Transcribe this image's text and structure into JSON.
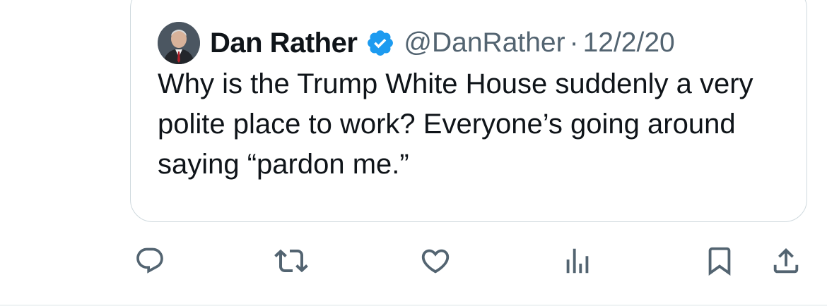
{
  "quoted_tweet": {
    "author_name": "Dan Rather",
    "handle": "@DanRather",
    "separator": "·",
    "date": "12/2/20",
    "text": "Why is the Trump White House suddenly a very polite place to work? Everyone’s going around saying “pardon me.”",
    "verified": true,
    "verified_color": "#1d9bf0"
  },
  "actions": {
    "icons": [
      "reply-icon",
      "retweet-icon",
      "like-icon",
      "views-icon",
      "bookmark-icon",
      "share-icon"
    ],
    "icon_color": "#536471"
  }
}
